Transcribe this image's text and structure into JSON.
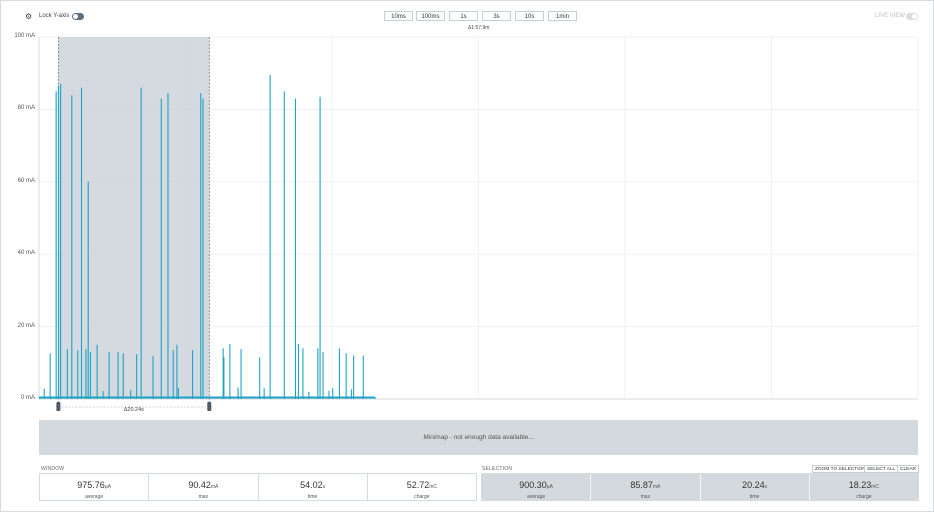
{
  "toolbar": {
    "lock_y_axis_label": "Lock Y-axis",
    "window_buttons": [
      "10ms",
      "100ms",
      "1s",
      "3s",
      "10s",
      "1min"
    ],
    "live_view_label": "LIVE VIEW",
    "window_duration": "Δ1:57.9m"
  },
  "chart_data": {
    "type": "line",
    "title": "",
    "xlabel": "",
    "ylabel": "",
    "y_ticks": [
      "100 mA",
      "80 mA",
      "60 mA",
      "40 mA",
      "20 mA",
      "0 mA"
    ],
    "ylim": [
      0,
      100
    ],
    "xlim": [
      0,
      117.9
    ],
    "grid": true,
    "unit": "mA",
    "color": "#1ea3c4",
    "series": [
      {
        "x": [
          0.1,
          0.7,
          1.5,
          1.6,
          2.3,
          2.6,
          2.9,
          3.8,
          4.4,
          5.2,
          5.7,
          6.3,
          6.6,
          6.9,
          7.8,
          8.6,
          9.4,
          10.6,
          11.3,
          12.3,
          13.1,
          13.7,
          15.3,
          16.4,
          17.3,
          18.0,
          18.5,
          18.7,
          20.6,
          21.7,
          22.0,
          24.7,
          24.8,
          25.6,
          26.7,
          27.1,
          29.6,
          30.2,
          31.0,
          32.9,
          34.4,
          34.8,
          35.4,
          36.2,
          37.4,
          37.7,
          38.1,
          38.9,
          39.4,
          40.3,
          41.2,
          41.9,
          42.2,
          43.5,
          45.1
        ],
        "y": [
          0.3,
          2.8,
          12.6,
          0.5,
          85.0,
          86.5,
          87.0,
          13.8,
          83.9,
          13.5,
          86.0,
          13.8,
          60.0,
          13.0,
          15.0,
          2.2,
          13.0,
          13.0,
          12.6,
          2.5,
          12.4,
          86.0,
          11.9,
          83.0,
          84.5,
          13.5,
          15.0,
          3.0,
          13.5,
          84.5,
          83.0,
          14.0,
          11.5,
          15.2,
          3.2,
          13.8,
          11.5,
          3.0,
          89.5,
          85.0,
          83.0,
          15.2,
          14.0,
          2.0,
          14.0,
          83.5,
          13.0,
          2.3,
          3.0,
          14.0,
          12.6,
          2.7,
          12.0,
          12.0,
          0.3
        ]
      }
    ]
  },
  "selection_marker": {
    "start_s": 2.6,
    "end_s": 22.84,
    "label": "Δ20.24s"
  },
  "minimap": {
    "message": "Minimap - not enough data available..."
  },
  "window_stats": {
    "title": "WINDOW",
    "items": [
      {
        "value": "975.76",
        "unit": "µA",
        "caption": "average"
      },
      {
        "value": "90.42",
        "unit": "mA",
        "caption": "max"
      },
      {
        "value": "54.02",
        "unit": "s",
        "caption": "time"
      },
      {
        "value": "52.72",
        "unit": "mC",
        "caption": "charge"
      }
    ]
  },
  "selection_stats": {
    "title": "SELECTION",
    "buttons": [
      "ZOOM TO SELECTION",
      "SELECT ALL",
      "CLEAR"
    ],
    "items": [
      {
        "value": "900.30",
        "unit": "µA",
        "caption": "average"
      },
      {
        "value": "85.87",
        "unit": "mA",
        "caption": "max"
      },
      {
        "value": "20.24",
        "unit": "s",
        "caption": "time"
      },
      {
        "value": "18.23",
        "unit": "mC",
        "caption": "charge"
      }
    ]
  }
}
